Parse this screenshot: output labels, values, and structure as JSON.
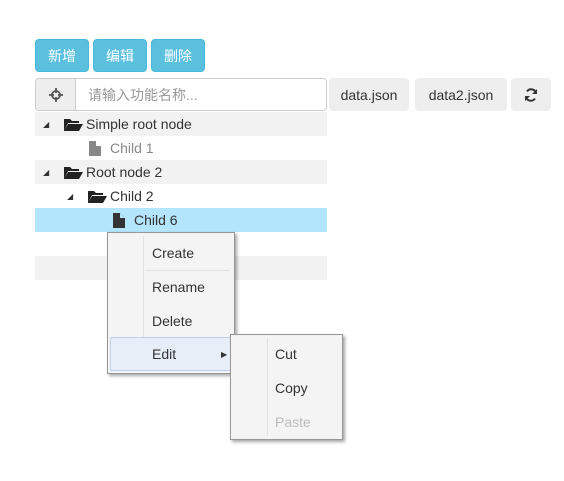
{
  "toolbar": {
    "add": "新增",
    "edit": "编辑",
    "delete": "删除"
  },
  "search": {
    "placeholder": "请输入功能名称...",
    "value": "",
    "icon": "crosshair-icon"
  },
  "files": {
    "data1": "data.json",
    "data2": "data2.json",
    "refresh_icon": "refresh-icon"
  },
  "tree": [
    {
      "label": "Simple root node",
      "type": "folder-open",
      "expanded": true
    },
    {
      "label": "Child 1",
      "type": "file",
      "disabled": true
    },
    {
      "label": "Root node 2",
      "type": "folder-open",
      "expanded": true
    },
    {
      "label": "Child 2",
      "type": "folder-open",
      "expanded": true
    },
    {
      "label": "Child 6",
      "type": "file",
      "selected": true
    }
  ],
  "context_menu": {
    "items": [
      "Create",
      "Rename",
      "Delete",
      "Edit"
    ],
    "highlighted": "Edit"
  },
  "submenu": {
    "items": [
      "Cut",
      "Copy",
      "Paste"
    ],
    "disabled": [
      "Paste"
    ]
  },
  "colors": {
    "accent": "#5bc0de",
    "selected": "#b3e5fc"
  }
}
